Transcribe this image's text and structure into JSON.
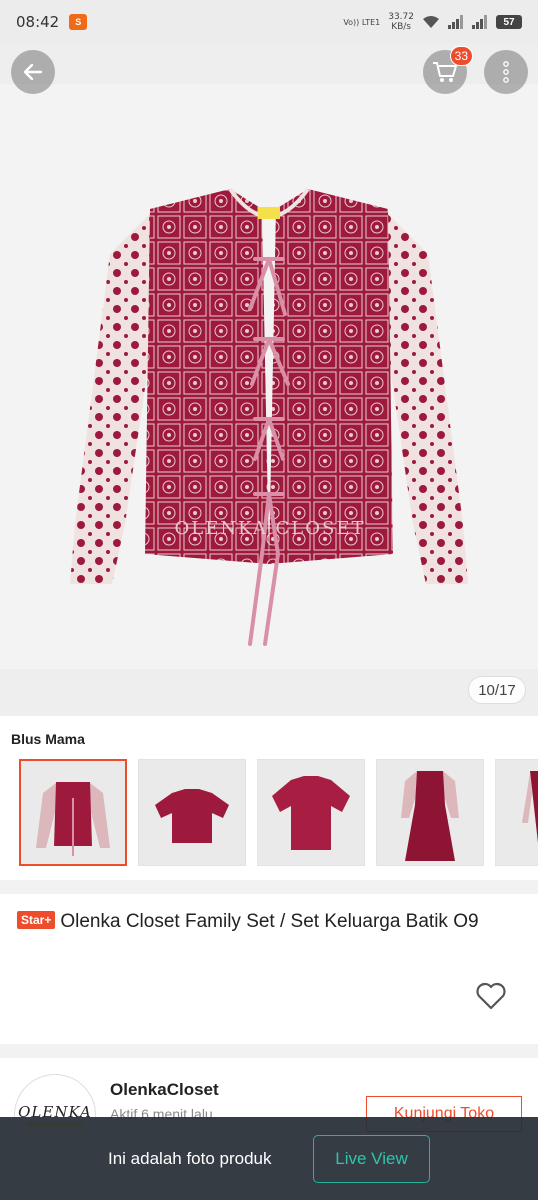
{
  "status_bar": {
    "time": "08:42",
    "network_type": "Vo)) LTE1",
    "speed_value": "33.72",
    "speed_unit": "KB/s",
    "battery": "57"
  },
  "gallery": {
    "cart_count": "33",
    "counter": "10/17",
    "watermark": "OLENKA CLOSET"
  },
  "variant": {
    "title": "Blus Mama",
    "thumbnails": [
      "blouse-mama",
      "boy-shirt",
      "men-shirt",
      "girl-dress",
      "dress-partial"
    ]
  },
  "product": {
    "badge": "Star+",
    "title": "Olenka Closet Family Set / Set Keluarga Batik O9"
  },
  "shop": {
    "logo_text": "OLENKA",
    "name": "OlenkaCloset",
    "active": "Aktif 6 menit lalu",
    "visit_label": "Kunjungi Toko"
  },
  "overlay": {
    "message": "Ini adalah foto produk",
    "live_label": "Live View"
  },
  "colors": {
    "accent": "#ee4d2d",
    "batik": "#9e1a3c",
    "live": "#27b39a"
  }
}
